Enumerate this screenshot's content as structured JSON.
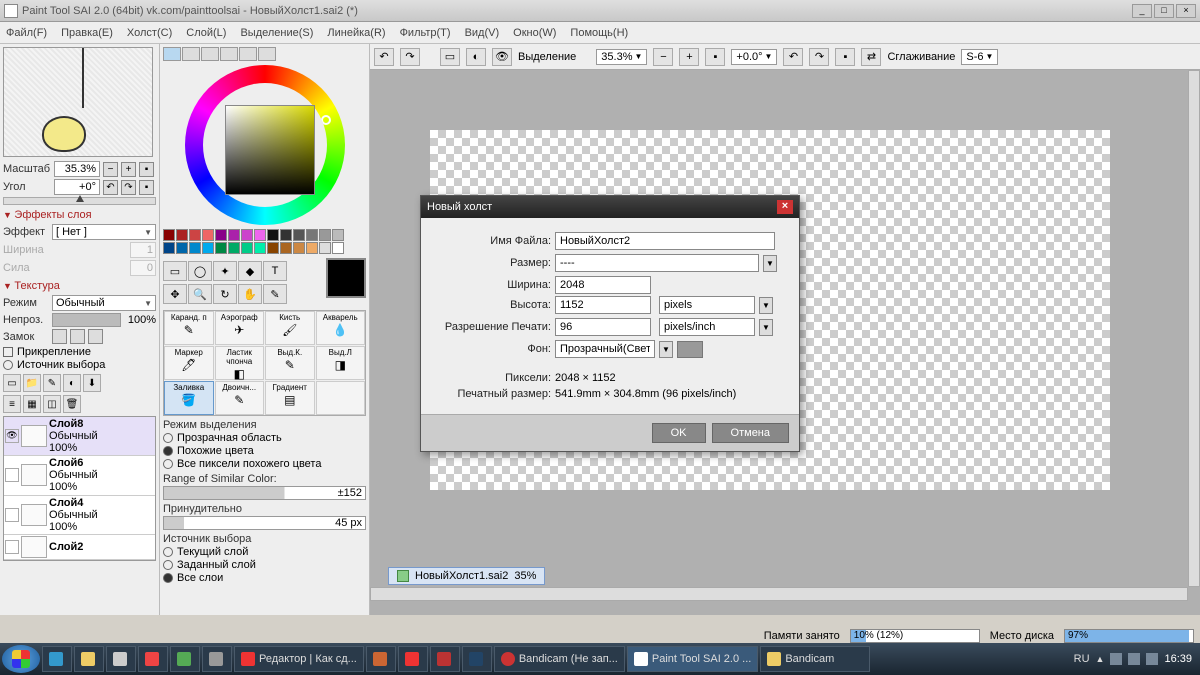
{
  "title": "Paint Tool SAI 2.0 (64bit) vk.com/painttoolsai - НовыйХолст1.sai2 (*)",
  "menu": {
    "file": "Файл(F)",
    "edit": "Правка(E)",
    "canvas": "Холст(C)",
    "layer": "Слой(L)",
    "select": "Выделение(S)",
    "ruler": "Линейка(R)",
    "filter": "Фильтр(T)",
    "view": "Вид(V)",
    "window": "Окно(W)",
    "help": "Помощь(H)"
  },
  "nav": {
    "scale_lbl": "Масштаб",
    "scale_val": "35.3%",
    "angle_lbl": "Угол",
    "angle_val": "+0°"
  },
  "fx": {
    "head": "Эффекты слоя",
    "effect_lbl": "Эффект",
    "effect_val": "[ Нет ]",
    "width_lbl": "Ширина",
    "width_val": "1",
    "str_lbl": "Сила",
    "str_val": "0"
  },
  "tex": {
    "head": "Текстура",
    "mode_lbl": "Режим",
    "mode_val": "Обычный",
    "opac_lbl": "Непроз.",
    "opac_val": "100%",
    "lock_lbl": "Замок",
    "pin_lbl": "Прикрепление",
    "src_lbl": "Источник выбора"
  },
  "layers": [
    {
      "name": "Слой8",
      "mode": "Обычный",
      "opac": "100%",
      "sel": true,
      "eye": true
    },
    {
      "name": "Слой6",
      "mode": "Обычный",
      "opac": "100%",
      "sel": false,
      "eye": false
    },
    {
      "name": "Слой4",
      "mode": "Обычный",
      "opac": "100%",
      "sel": false,
      "eye": false
    },
    {
      "name": "Слой2",
      "mode": "",
      "opac": "",
      "sel": false,
      "eye": false
    }
  ],
  "brushes": {
    "r1": [
      "Каранд. п",
      "Аэрограф",
      "Кисть",
      "Акварель"
    ],
    "r2": [
      "Маркер",
      "Ластик чпонча",
      "Выд.К.",
      "Выд.Л"
    ],
    "r3": [
      "Заливка",
      "Двоичн...",
      "Градиент",
      ""
    ]
  },
  "selmode": {
    "head": "Режим выделения",
    "o1": "Прозрачная область",
    "o2": "Похожие цвета",
    "o3": "Все пиксели похожего цвета",
    "range_lbl": "Range of Similar Color:",
    "range_val": "±152",
    "force_lbl": "Принудительно",
    "force_val": "45 px"
  },
  "pick": {
    "head": "Источник выбора",
    "o1": "Текущий слой",
    "o2": "Заданный слой",
    "o3": "Все слои"
  },
  "ctb": {
    "sel_lbl": "Выделение",
    "zoom": "35.3%",
    "rot": "+0.0°",
    "smooth_lbl": "Сглаживание",
    "smooth_val": "S-6"
  },
  "doc": {
    "name": "НовыйХолст1.sai2",
    "zoom": "35%"
  },
  "dialog": {
    "title": "Новый холст",
    "fname_lbl": "Имя Файла:",
    "fname_val": "НовыйХолст2",
    "size_lbl": "Размер:",
    "size_val": "----",
    "w_lbl": "Ширина:",
    "w_val": "2048",
    "h_lbl": "Высота:",
    "h_val": "1152",
    "unit": "pixels",
    "res_lbl": "Разрешение Печати:",
    "res_val": "96",
    "res_unit": "pixels/inch",
    "bg_lbl": "Фон:",
    "bg_val": "Прозрачный(Свет",
    "px_lbl": "Пиксели:",
    "px_val": "2048 × 1152",
    "print_lbl": "Печатный размер:",
    "print_val": "541.9mm × 304.8mm (96 pixels/inch)",
    "ok": "OK",
    "cancel": "Отмена"
  },
  "status": {
    "mem_lbl": "Памяти занято",
    "mem_val": "10% (12%)",
    "disk_lbl": "Место диска",
    "disk_val": "97%"
  },
  "taskbar": {
    "items": [
      {
        "label": "Редактор | Как сд..."
      },
      {
        "label": ""
      },
      {
        "label": ""
      },
      {
        "label": ""
      },
      {
        "label": ""
      },
      {
        "label": "Bandicam (Не зап..."
      },
      {
        "label": "Paint Tool SAI 2.0 ..."
      },
      {
        "label": "Bandicam"
      }
    ],
    "lang": "RU",
    "clock": "16:39"
  }
}
